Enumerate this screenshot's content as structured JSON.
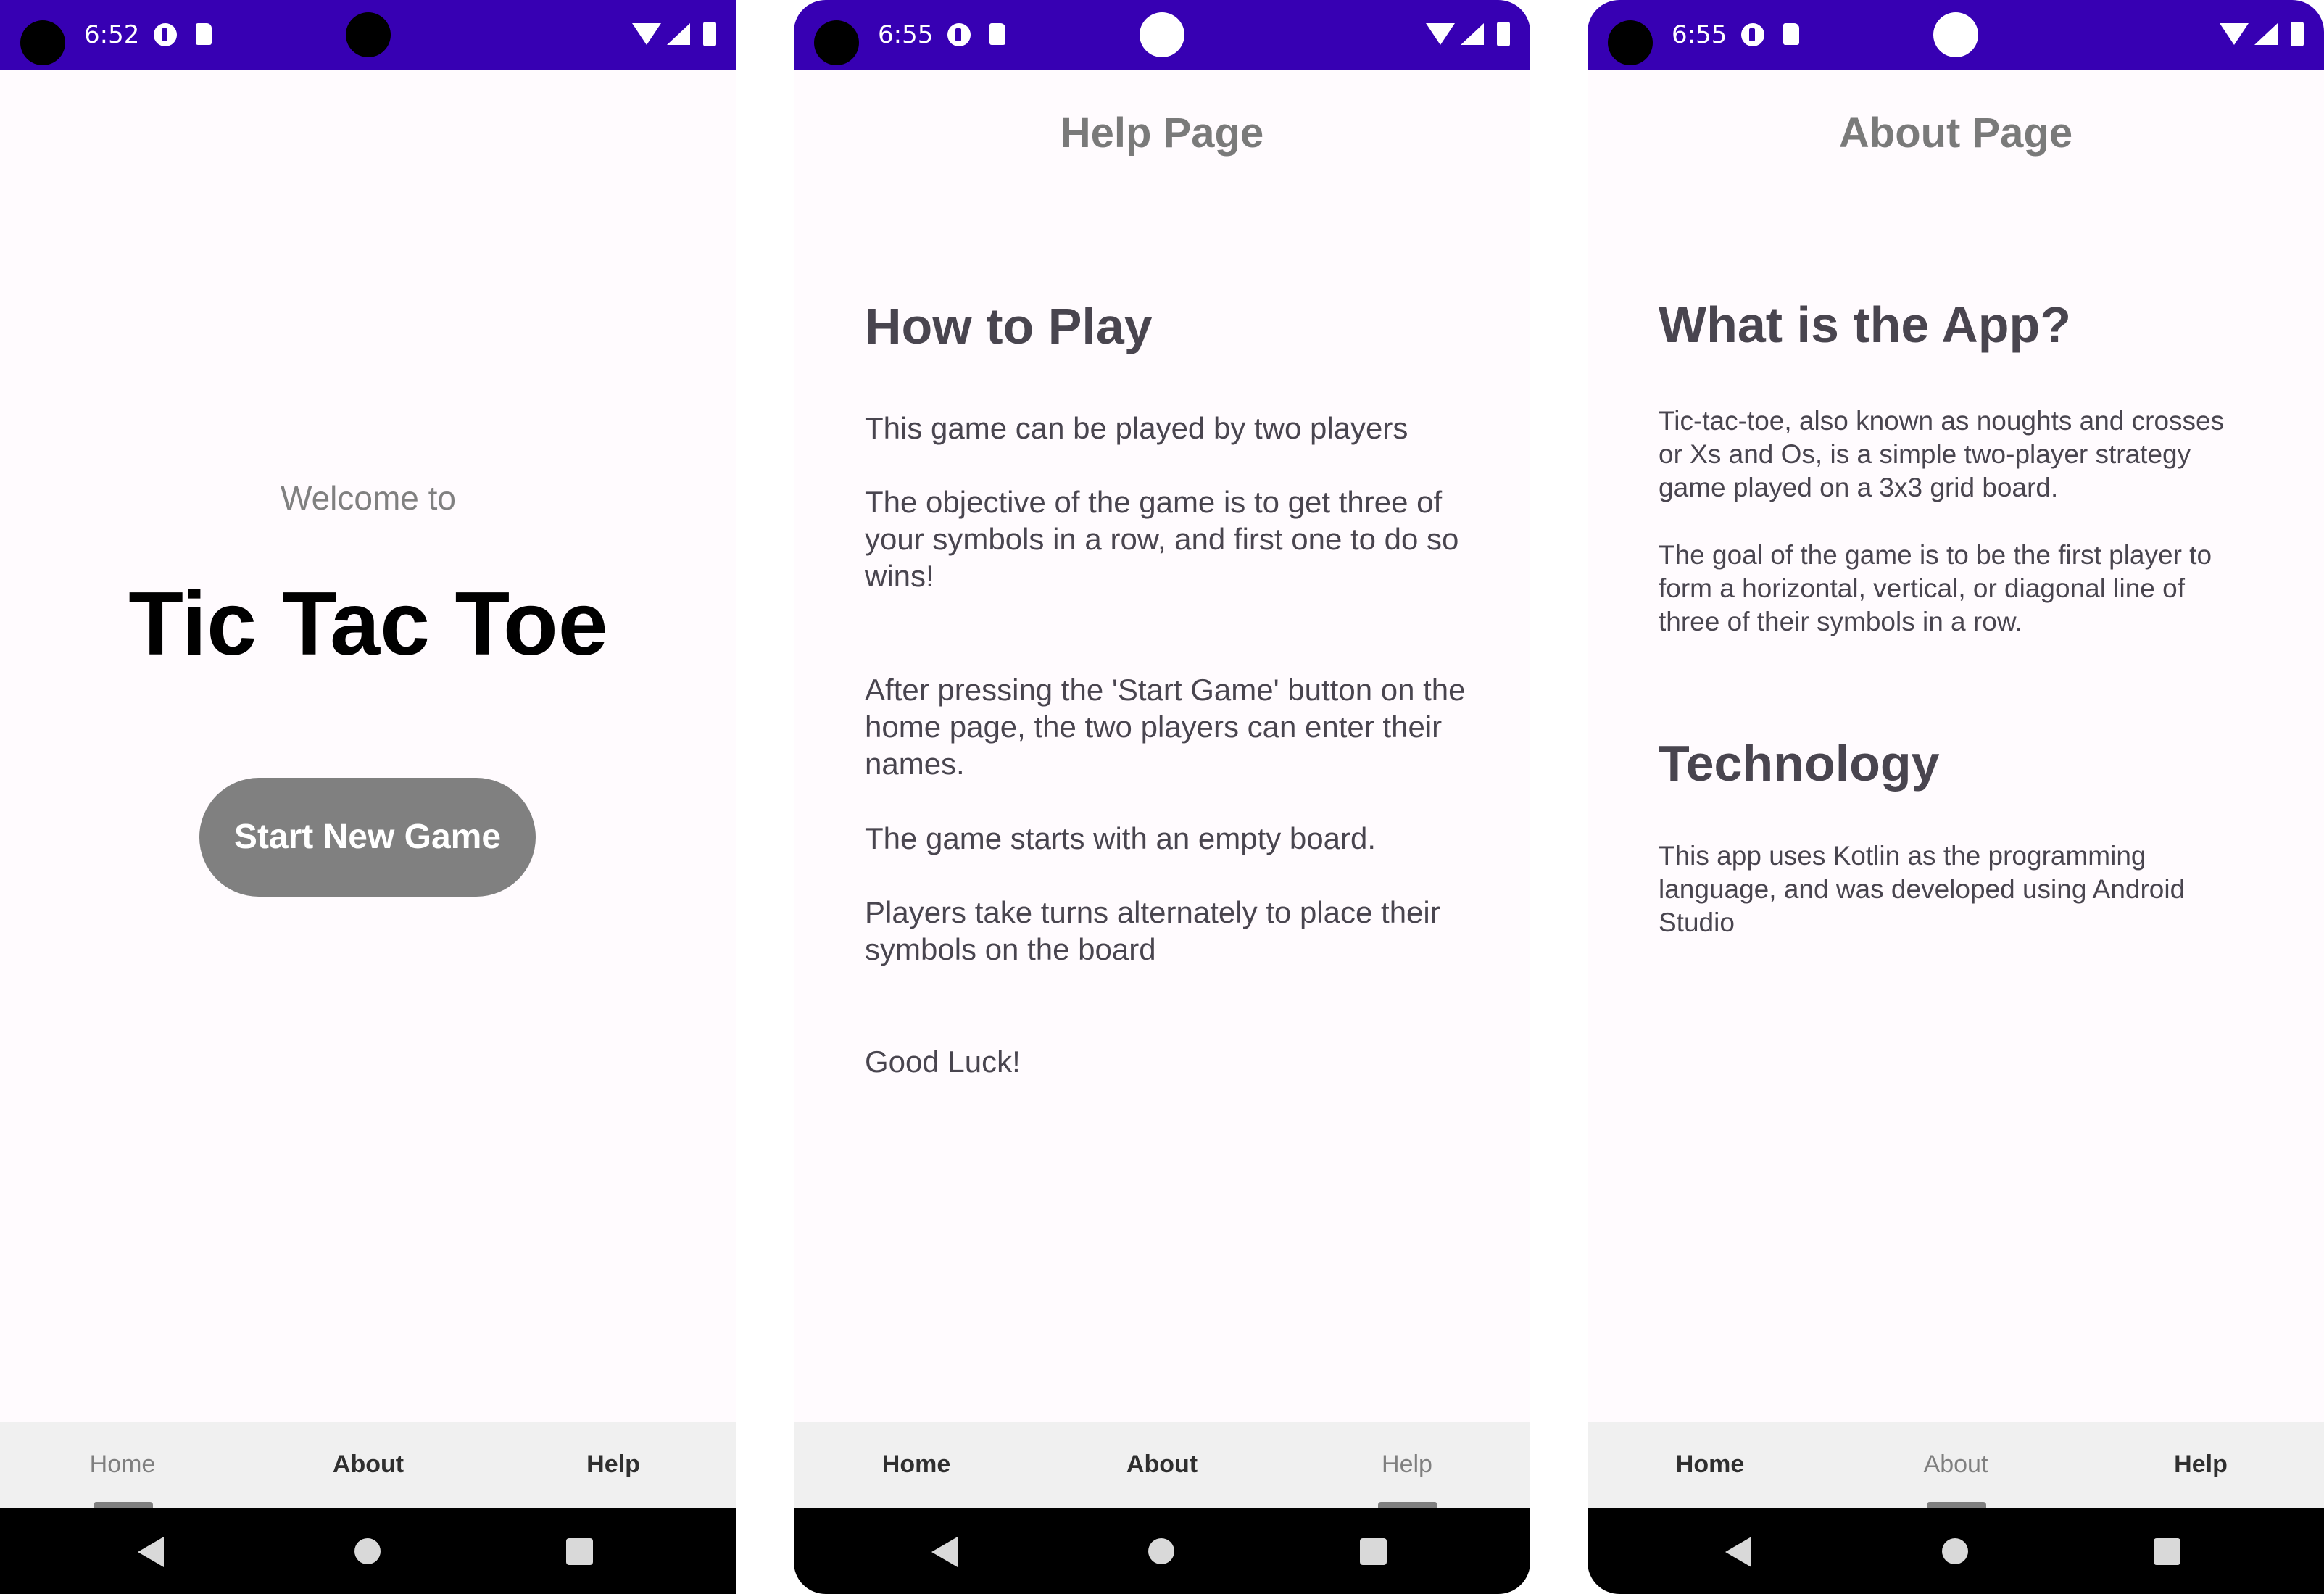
{
  "colors": {
    "status_bar": "#3700b3",
    "screen_bg": "#fffbfe",
    "nav_bar": "#f0f0f0",
    "button": "#808080",
    "heading_text": "#49454f"
  },
  "screens": [
    {
      "status": {
        "time": "6:52",
        "icons": [
          "camera-cutout-icon",
          "data-saver-icon",
          "sd-card-icon",
          "wifi-icon",
          "cell-signal-icon",
          "battery-icon"
        ]
      },
      "welcome": "Welcome to",
      "app_title": "Tic Tac Toe",
      "start_button": "Start New Game",
      "nav": {
        "home": "Home",
        "about": "About",
        "help": "Help",
        "active": "Home"
      }
    },
    {
      "status": {
        "time": "6:55",
        "icons": [
          "camera-cutout-icon",
          "data-saver-icon",
          "sd-card-icon",
          "wifi-icon",
          "cell-signal-icon",
          "battery-icon"
        ]
      },
      "page_title": "Help Page",
      "heading": "How to Play",
      "paragraphs": [
        "This game can be played by two players",
        "The objective of the game is to get three of your symbols in a row, and first one to do so wins!",
        "After pressing the 'Start Game' button on the home page, the two players can enter their names.",
        "The game starts with an empty board.",
        "Players take turns alternately to place their symbols on the board",
        "Good Luck!"
      ],
      "nav": {
        "home": "Home",
        "about": "About",
        "help": "Help",
        "active": "Help"
      }
    },
    {
      "status": {
        "time": "6:55",
        "icons": [
          "camera-cutout-icon",
          "data-saver-icon",
          "sd-card-icon",
          "wifi-icon",
          "cell-signal-icon",
          "battery-icon"
        ]
      },
      "page_title": "About Page",
      "heading_1": "What is the App?",
      "paragraphs_1": [
        "Tic-tac-toe, also known as noughts and crosses or Xs and Os, is a simple two-player strategy game played on a 3x3 grid board.",
        "The goal of the game is to be the first player to form a horizontal, vertical, or diagonal line of three of their symbols in a row."
      ],
      "heading_2": "Technology",
      "paragraphs_2": [
        "This app uses Kotlin as the programming language, and was developed using Android Studio"
      ],
      "nav": {
        "home": "Home",
        "about": "About",
        "help": "Help",
        "active": "About"
      }
    }
  ]
}
